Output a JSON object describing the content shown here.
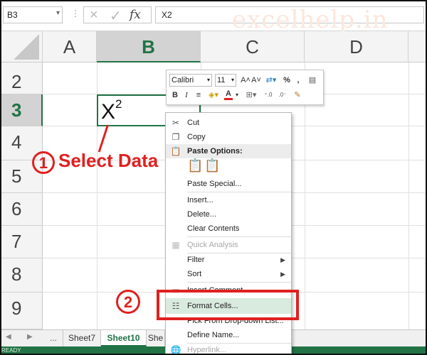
{
  "formula_bar": {
    "name_box": "B3",
    "dots": "⋮",
    "cancel_icon": "×",
    "enter_icon": "✓",
    "fx_label": "fx",
    "formula_value": "X2"
  },
  "watermark": "excelhelp.in",
  "columns": [
    "A",
    "B",
    "C",
    "D"
  ],
  "rows": [
    "2",
    "3",
    "4",
    "5",
    "6",
    "7",
    "8",
    "9"
  ],
  "active_cell": {
    "base": "X",
    "sup": "2"
  },
  "annotations": {
    "step1_number": "1",
    "step1_text": "Select Data",
    "step2_number": "2",
    "color": "#e02020"
  },
  "mini_toolbar": {
    "font": "Calibri",
    "size": "11",
    "grow": "A˄",
    "shrink": "A˅",
    "percent": "%",
    "comma": ",",
    "bold": "B",
    "italic": "I",
    "font_color": "A"
  },
  "context_menu": {
    "items": [
      {
        "label": "Cut",
        "icon": "scissors-icon"
      },
      {
        "label": "Copy",
        "icon": "copy-icon"
      },
      {
        "label": "Paste Options:",
        "icon": "paste-icon"
      },
      {
        "label": "Paste Special..."
      },
      {
        "label": "Insert..."
      },
      {
        "label": "Delete..."
      },
      {
        "label": "Clear Contents"
      },
      {
        "label": "Quick Analysis",
        "icon": "quick-analysis-icon",
        "disabled": true
      },
      {
        "label": "Filter",
        "submenu": true
      },
      {
        "label": "Sort",
        "submenu": true
      },
      {
        "label": "Insert Comment",
        "icon": "comment-icon"
      },
      {
        "label": "Format Cells...",
        "icon": "format-cells-icon",
        "highlighted": true
      },
      {
        "label": "Pick From Drop-down List..."
      },
      {
        "label": "Define Name..."
      },
      {
        "label": "Hyperlink...",
        "icon": "hyperlink-icon",
        "disabled": true
      }
    ]
  },
  "sheet_tabs": {
    "dots": "...",
    "tabs": [
      "Sheet7",
      "Sheet10",
      "She"
    ],
    "active": "Sheet10"
  },
  "status_bar": {
    "text": "READY"
  },
  "colors": {
    "excel_green": "#217346",
    "highlight": "#d9eadf"
  }
}
